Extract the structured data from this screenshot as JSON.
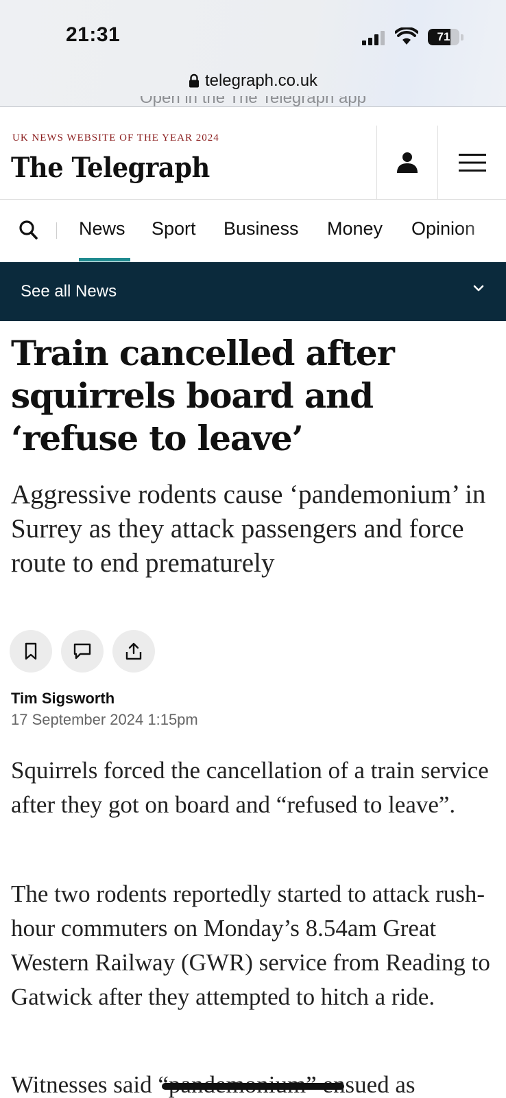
{
  "status_bar": {
    "time": "21:31",
    "battery_level": "71"
  },
  "browser": {
    "url": "telegraph.co.uk",
    "app_banner": "Open in the The Telegraph app"
  },
  "header": {
    "award": "UK NEWS WEBSITE OF THE YEAR 2024",
    "logo": "The Telegraph",
    "icons": [
      "account-icon",
      "hamburger-menu-icon"
    ]
  },
  "nav": {
    "items": [
      "News",
      "Sport",
      "Business",
      "Money",
      "Opinion"
    ],
    "active": "News",
    "accent": "#1f8a8f"
  },
  "subnav": {
    "label": "See all News",
    "background": "#0b2a3c"
  },
  "article": {
    "headline": "Train cancelled after squirrels board and ‘refuse to leave’",
    "standfirst": "Aggressive rodents cause ‘pandemonium’ in Surrey as they attack passengers and force route to end prematurely",
    "actions": [
      "bookmark-icon",
      "comment-icon",
      "share-icon"
    ],
    "author": "Tim Sigsworth",
    "date": "17 September 2024 1:15pm",
    "paragraphs": [
      "Squirrels forced the cancellation of a train service after they got on board and “refused to leave”.",
      "The two rodents reportedly started to attack rush-hour commuters on Monday’s 8.54am Great Western Railway (GWR) service from Reading to Gatwick after they attempted to hitch a ride.",
      "Witnesses said “pandemonium” ensued as"
    ]
  }
}
